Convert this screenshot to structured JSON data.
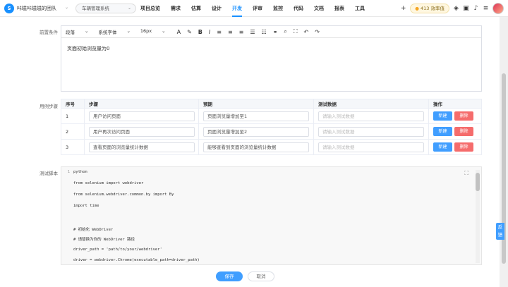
{
  "nav": {
    "team": "咔嗞咔嗞嗞的团队",
    "project": "车辆管理系统",
    "menu": [
      "项目总览",
      "需求",
      "估算",
      "设计",
      "开发",
      "评审",
      "监控",
      "代码",
      "文档",
      "报表",
      "工具"
    ],
    "active_menu": "开发",
    "coins": "413",
    "coins_label": "效率值"
  },
  "form": {
    "precondition_label": "前置条件",
    "steps_label": "用例步骤",
    "script_label": "测试脚本",
    "toolbar": {
      "paragraph": "段落",
      "font": "系统字体",
      "size": "16px"
    },
    "precondition_text": "页面初始浏览量为0"
  },
  "steps_table": {
    "headers": [
      "序号",
      "步骤",
      "预期",
      "测试数据",
      "操作"
    ],
    "rows": [
      {
        "no": "1",
        "step": "用户访问页面",
        "expected": "页面浏览量增加至1",
        "data_placeholder": "请输入测试数据"
      },
      {
        "no": "2",
        "step": "用户再次访问页面",
        "expected": "页面浏览量增加至2",
        "data_placeholder": "请输入测试数据"
      },
      {
        "no": "3",
        "step": "查看页面的浏览量统计数据",
        "expected": "能够查看到页面的浏览量统计数据",
        "data_placeholder": "请输入测试数据"
      }
    ],
    "new_label": "新建",
    "delete_label": "删除"
  },
  "code": {
    "lines": [
      {
        "n": "1",
        "text": "python"
      },
      {
        "n": "",
        "text": "from selenium import webdriver"
      },
      {
        "n": "",
        "text": "from selenium.webdriver.common.by import By"
      },
      {
        "n": "",
        "text": "import time"
      },
      {
        "n": "",
        "text": ""
      },
      {
        "n": "",
        "text": "# 初始化 WebDriver"
      },
      {
        "n": "",
        "text": "# 请替换为你的 WebDriver 路径"
      },
      {
        "n": "",
        "text": "driver_path = 'path/to/your/webdriver'"
      },
      {
        "n": "",
        "text": "driver = webdriver.Chrome(executable_path=driver_path)"
      }
    ]
  },
  "buttons": {
    "save": "保存",
    "cancel": "取消"
  },
  "feedback": "反馈"
}
